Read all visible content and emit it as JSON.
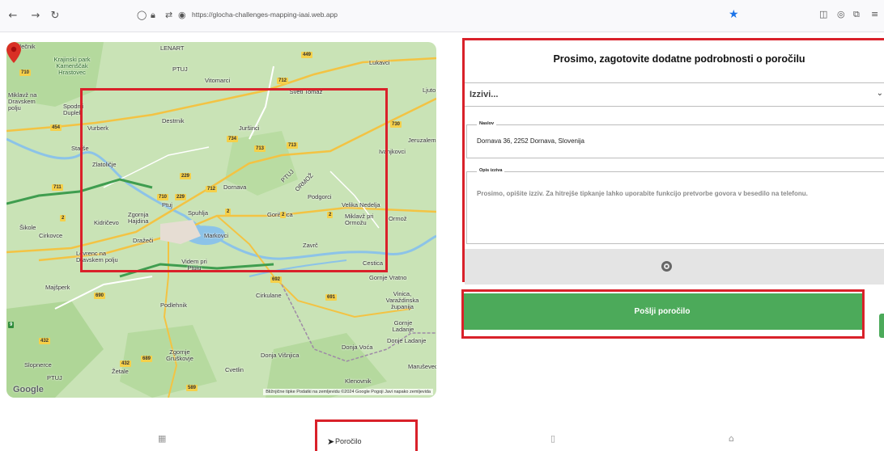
{
  "browser": {
    "url": "https://glocha-challenges-mapping-iaai.web.app"
  },
  "map": {
    "places": [
      {
        "name": "Malečnik"
      },
      {
        "name": "LENART"
      },
      {
        "name": "Krajinski park Kamenščak Hrastovec"
      },
      {
        "name": "PTUJ"
      },
      {
        "name": "Vitomarci"
      },
      {
        "name": "Lukavci"
      },
      {
        "name": "Miklavž na Dravskem polju"
      },
      {
        "name": "Spodnji Duplek"
      },
      {
        "name": "Sveti Tomaž"
      },
      {
        "name": "Ljuto"
      },
      {
        "name": "Destrnik"
      },
      {
        "name": "Juršinci"
      },
      {
        "name": "Vurberk"
      },
      {
        "name": "Jeruzalem"
      },
      {
        "name": "Starše"
      },
      {
        "name": "Ivanjkovci"
      },
      {
        "name": "Zlatoličje"
      },
      {
        "name": "Dornava"
      },
      {
        "name": "PTUJ"
      },
      {
        "name": "ORMOŽ"
      },
      {
        "name": "Podgorci"
      },
      {
        "name": "Ptuj"
      },
      {
        "name": "Spuhlja"
      },
      {
        "name": "Velika Nedelja"
      },
      {
        "name": "Zgornja Hajdina"
      },
      {
        "name": "Gorišnica"
      },
      {
        "name": "Miklavž pri Ormožu"
      },
      {
        "name": "Ormož"
      },
      {
        "name": "Kidričevo"
      },
      {
        "name": "Šikole"
      },
      {
        "name": "Cirkovce"
      },
      {
        "name": "Dražeči"
      },
      {
        "name": "Markovci"
      },
      {
        "name": "Zavrč"
      },
      {
        "name": "Lovrenc na Dravskem polju"
      },
      {
        "name": "Videm pri Ptuju"
      },
      {
        "name": "Cestica"
      },
      {
        "name": "Gornje Vratno"
      },
      {
        "name": "Majšperk"
      },
      {
        "name": "Cirkulane"
      },
      {
        "name": "Vinica, Varaždinska županija"
      },
      {
        "name": "Podlehnik"
      },
      {
        "name": "Gornje Ladanje"
      },
      {
        "name": "Zgornje Gruškovje"
      },
      {
        "name": "Donja Voća"
      },
      {
        "name": "Donje Ladanje"
      },
      {
        "name": "Donja Višnjica"
      },
      {
        "name": "Slopnerce"
      },
      {
        "name": "Žetale"
      },
      {
        "name": "Cvetlin"
      },
      {
        "name": "Maruševec"
      },
      {
        "name": "PTUJ"
      },
      {
        "name": "Klenovnik"
      }
    ],
    "road_numbers": [
      "710",
      "449",
      "712",
      "454",
      "730",
      "229",
      "711",
      "712",
      "713",
      "713",
      "734",
      "710",
      "229",
      "2",
      "2",
      "2",
      "2",
      "692",
      "690",
      "691",
      "432",
      "689",
      "432",
      "9",
      "589"
    ],
    "attribution": "Bližnjične tipke   Podatki na zemljevidu ©2024 Google   Pogoji   Javi napako zemljevida",
    "logo_text": "Google"
  },
  "form": {
    "title": "Prosimo, zagotovite dodatne podrobnosti o poročilu",
    "challenge_select": {
      "value": "Izzivi..."
    },
    "address": {
      "legend": "Naslov",
      "value": "Dornava 36, 2252 Dornava, Slovenija"
    },
    "description": {
      "legend": "Opis izziva",
      "placeholder": "Prosimo, opišite izziv. Za hitrejše tipkanje lahko uporabite funkcijo pretvorbe govora v besedilo na telefonu."
    },
    "photo_icon": "camera-icon",
    "submit_label": "Pošlji poročilo"
  },
  "bottom_nav": {
    "report_label": "Poročilo",
    "icons": [
      "dashboard-icon",
      "send-icon",
      "map-icon",
      "home-icon"
    ]
  },
  "colors": {
    "highlight": "#d9212a",
    "submit": "#4caa5a",
    "map_land": "#c9e3b6"
  }
}
